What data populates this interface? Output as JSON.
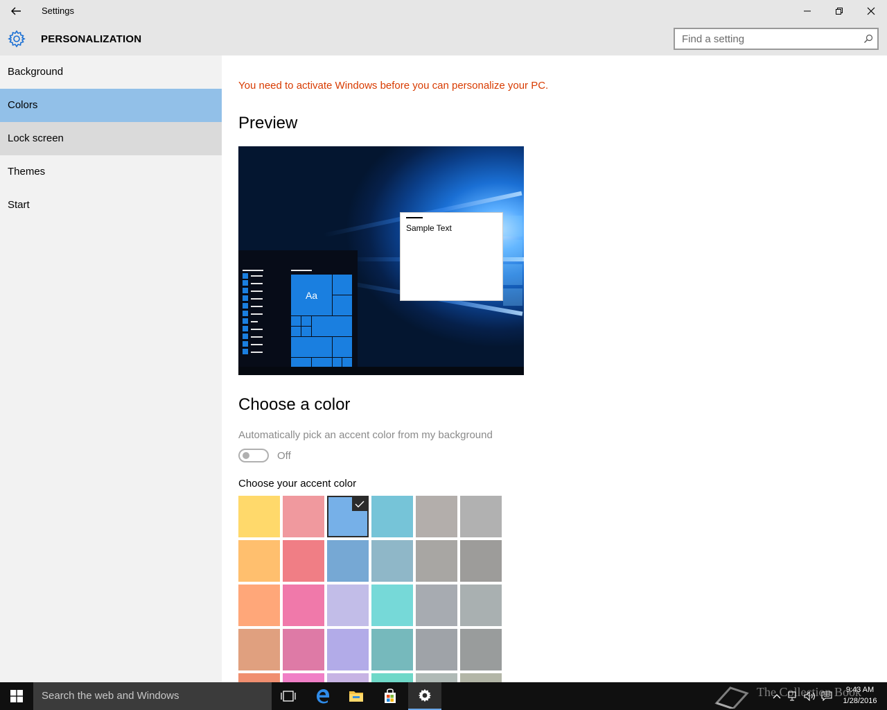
{
  "window": {
    "title": "Settings",
    "icons": {
      "back": "back-arrow-icon",
      "minimize": "minimize-icon",
      "restore": "restore-icon",
      "close": "close-icon"
    }
  },
  "header": {
    "section_title": "PERSONALIZATION",
    "icon": "gear-icon",
    "search_placeholder": "Find a setting",
    "search_value": ""
  },
  "sidebar": {
    "items": [
      {
        "label": "Background",
        "state": "normal"
      },
      {
        "label": "Colors",
        "state": "selected"
      },
      {
        "label": "Lock screen",
        "state": "hover"
      },
      {
        "label": "Themes",
        "state": "normal"
      },
      {
        "label": "Start",
        "state": "normal"
      }
    ]
  },
  "main": {
    "activation_warning": "You need to activate Windows before you can personalize your PC.",
    "preview_heading": "Preview",
    "preview": {
      "sample_text": "Sample Text",
      "tile_label": "Aa"
    },
    "choose_heading": "Choose a color",
    "auto_pick_label": "Automatically pick an accent color from my background",
    "auto_pick_state": "Off",
    "accent_label": "Choose your accent color",
    "selected_accent": "#76b0e8",
    "accent_colors": [
      [
        "#ffd96b",
        "#f0999e",
        "#76b0e8",
        "#76c4d8",
        "#b3aeab",
        "#b1b1b1"
      ],
      [
        "#ffbf6e",
        "#f07e85",
        "#76a8d4",
        "#8fb7c8",
        "#a8a6a3",
        "#9d9c9a"
      ],
      [
        "#ffa779",
        "#f079aa",
        "#c2bde8",
        "#76d9d8",
        "#a7abb1",
        "#a9b0b1"
      ],
      [
        "#e0a07f",
        "#de7aa6",
        "#b2abe8",
        "#76b9bc",
        "#9fa3a8",
        "#999c9c"
      ],
      [
        "#f08f70",
        "#f07fc6",
        "#c7b4e4",
        "#6fd8c8",
        "#b0bab6",
        "#b3b6a7"
      ]
    ]
  },
  "taskbar": {
    "search_placeholder": "Search the web and Windows",
    "watermark": "The Collection Book",
    "time": "9:43 AM",
    "date": "1/28/2016",
    "icons": [
      "windows-start-icon",
      "task-view-icon",
      "edge-icon",
      "file-explorer-icon",
      "store-icon",
      "settings-gear-icon"
    ],
    "tray_icons": [
      "chevron-up-icon",
      "network-icon",
      "volume-icon",
      "action-center-icon"
    ]
  }
}
